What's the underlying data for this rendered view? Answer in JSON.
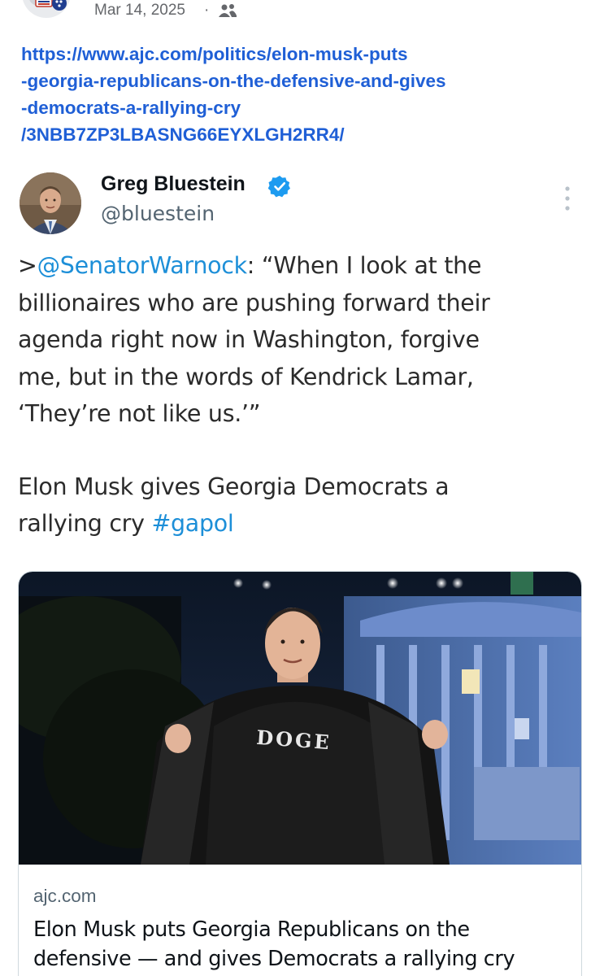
{
  "post_meta": {
    "date": "Mar 14, 2025",
    "separator": "·",
    "audience_icon": "group-icon"
  },
  "link": {
    "url": "https://www.ajc.com/politics/elon-musk-puts-georgia-republicans-on-the-defensive-and-gives-democrats-a-rallying-cry/3NBB7ZP3LBASNG66EYXLGH2RR4/",
    "lines": [
      "https://www.ajc.com/politics/elon-musk-puts",
      "-georgia-republicans-on-the-defensive-and-gives",
      "-democrats-a-rallying-cry",
      "/3NBB7ZP3LBASNG66EYXLGH2RR4/"
    ]
  },
  "tweet": {
    "author_name": "Greg Bluestein",
    "author_handle": "@bluestein",
    "verified_icon": "verified-badge-icon",
    "more_icon": "vertical-ellipsis-icon",
    "quote_prefix": ">",
    "mention": "@SenatorWarnock",
    "line1_rest": ": “When I look at the",
    "line2": "billionaires who are pushing forward their",
    "line3": "agenda right now in Washington, forgive",
    "line4": "me, but in the words of Kendrick Lamar,",
    "line5": "‘They’re not like us.’”",
    "line6": "Elon Musk gives Georgia Democrats a",
    "line7_text": "rallying cry ",
    "hashtag": "#gapol",
    "mention_color": "#1d8fd8"
  },
  "card": {
    "domain": "ajc.com",
    "title_line1": "Elon Musk puts Georgia Republicans on the",
    "title_line2": "defensive — and gives Democrats a rallying cry",
    "shirt_text": "DOGE"
  }
}
